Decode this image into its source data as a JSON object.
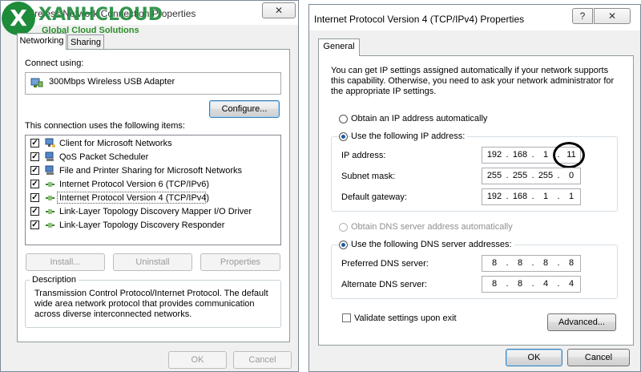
{
  "left_dialog": {
    "title": "Wireless Network Connection Properties",
    "tabs": [
      "Networking",
      "Sharing"
    ],
    "connect_using_label": "Connect using:",
    "adapter_name": "300Mbps Wireless USB Adapter",
    "configure_button": "Configure...",
    "items_label": "This connection uses the following items:",
    "items": [
      {
        "label": "Client for Microsoft Networks",
        "checked": true,
        "icon": "network-client-icon"
      },
      {
        "label": "QoS Packet Scheduler",
        "checked": true,
        "icon": "network-service-icon"
      },
      {
        "label": "File and Printer Sharing for Microsoft Networks",
        "checked": true,
        "icon": "network-service-icon"
      },
      {
        "label": "Internet Protocol Version 6 (TCP/IPv6)",
        "checked": true,
        "icon": "protocol-icon"
      },
      {
        "label": "Internet Protocol Version 4 (TCP/IPv4)",
        "checked": true,
        "icon": "protocol-icon"
      },
      {
        "label": "Link-Layer Topology Discovery Mapper I/O Driver",
        "checked": true,
        "icon": "protocol-icon"
      },
      {
        "label": "Link-Layer Topology Discovery Responder",
        "checked": true,
        "icon": "protocol-icon"
      }
    ],
    "install_button": "Install...",
    "uninstall_button": "Uninstall",
    "properties_button": "Properties",
    "description_label": "Description",
    "description_text": "Transmission Control Protocol/Internet Protocol. The default wide area network protocol that provides communication across diverse interconnected networks.",
    "ok_button": "OK",
    "cancel_button": "Cancel"
  },
  "logo": {
    "brand": "XANHCLOUD",
    "tagline": "Global Cloud Solutions",
    "mark": "X",
    "color": "#1e8b3a"
  },
  "right_dialog": {
    "title": "Internet Protocol Version 4 (TCP/IPv4) Properties",
    "help_button": "?",
    "close_button": "✕",
    "tab": "General",
    "intro": "You can get IP settings assigned automatically if your network supports this capability. Otherwise, you need to ask your network administrator for the appropriate IP settings.",
    "obtain_ip_auto": "Obtain an IP address automatically",
    "use_following_ip": "Use the following IP address:",
    "ip_address_label": "IP address:",
    "ip_address": [
      "192",
      "168",
      "1",
      "11"
    ],
    "subnet_mask_label": "Subnet mask:",
    "subnet_mask": [
      "255",
      "255",
      "255",
      "0"
    ],
    "default_gateway_label": "Default gateway:",
    "default_gateway": [
      "192",
      "168",
      "1",
      "1"
    ],
    "obtain_dns_auto": "Obtain DNS server address automatically",
    "use_following_dns": "Use the following DNS server addresses:",
    "preferred_dns_label": "Preferred DNS server:",
    "preferred_dns": [
      "8",
      "8",
      "8",
      "8"
    ],
    "alternate_dns_label": "Alternate DNS server:",
    "alternate_dns": [
      "8",
      "8",
      "4",
      "4"
    ],
    "validate_label": "Validate settings upon exit",
    "advanced_button": "Advanced...",
    "ok_button": "OK",
    "cancel_button": "Cancel",
    "octet_separator": "."
  }
}
